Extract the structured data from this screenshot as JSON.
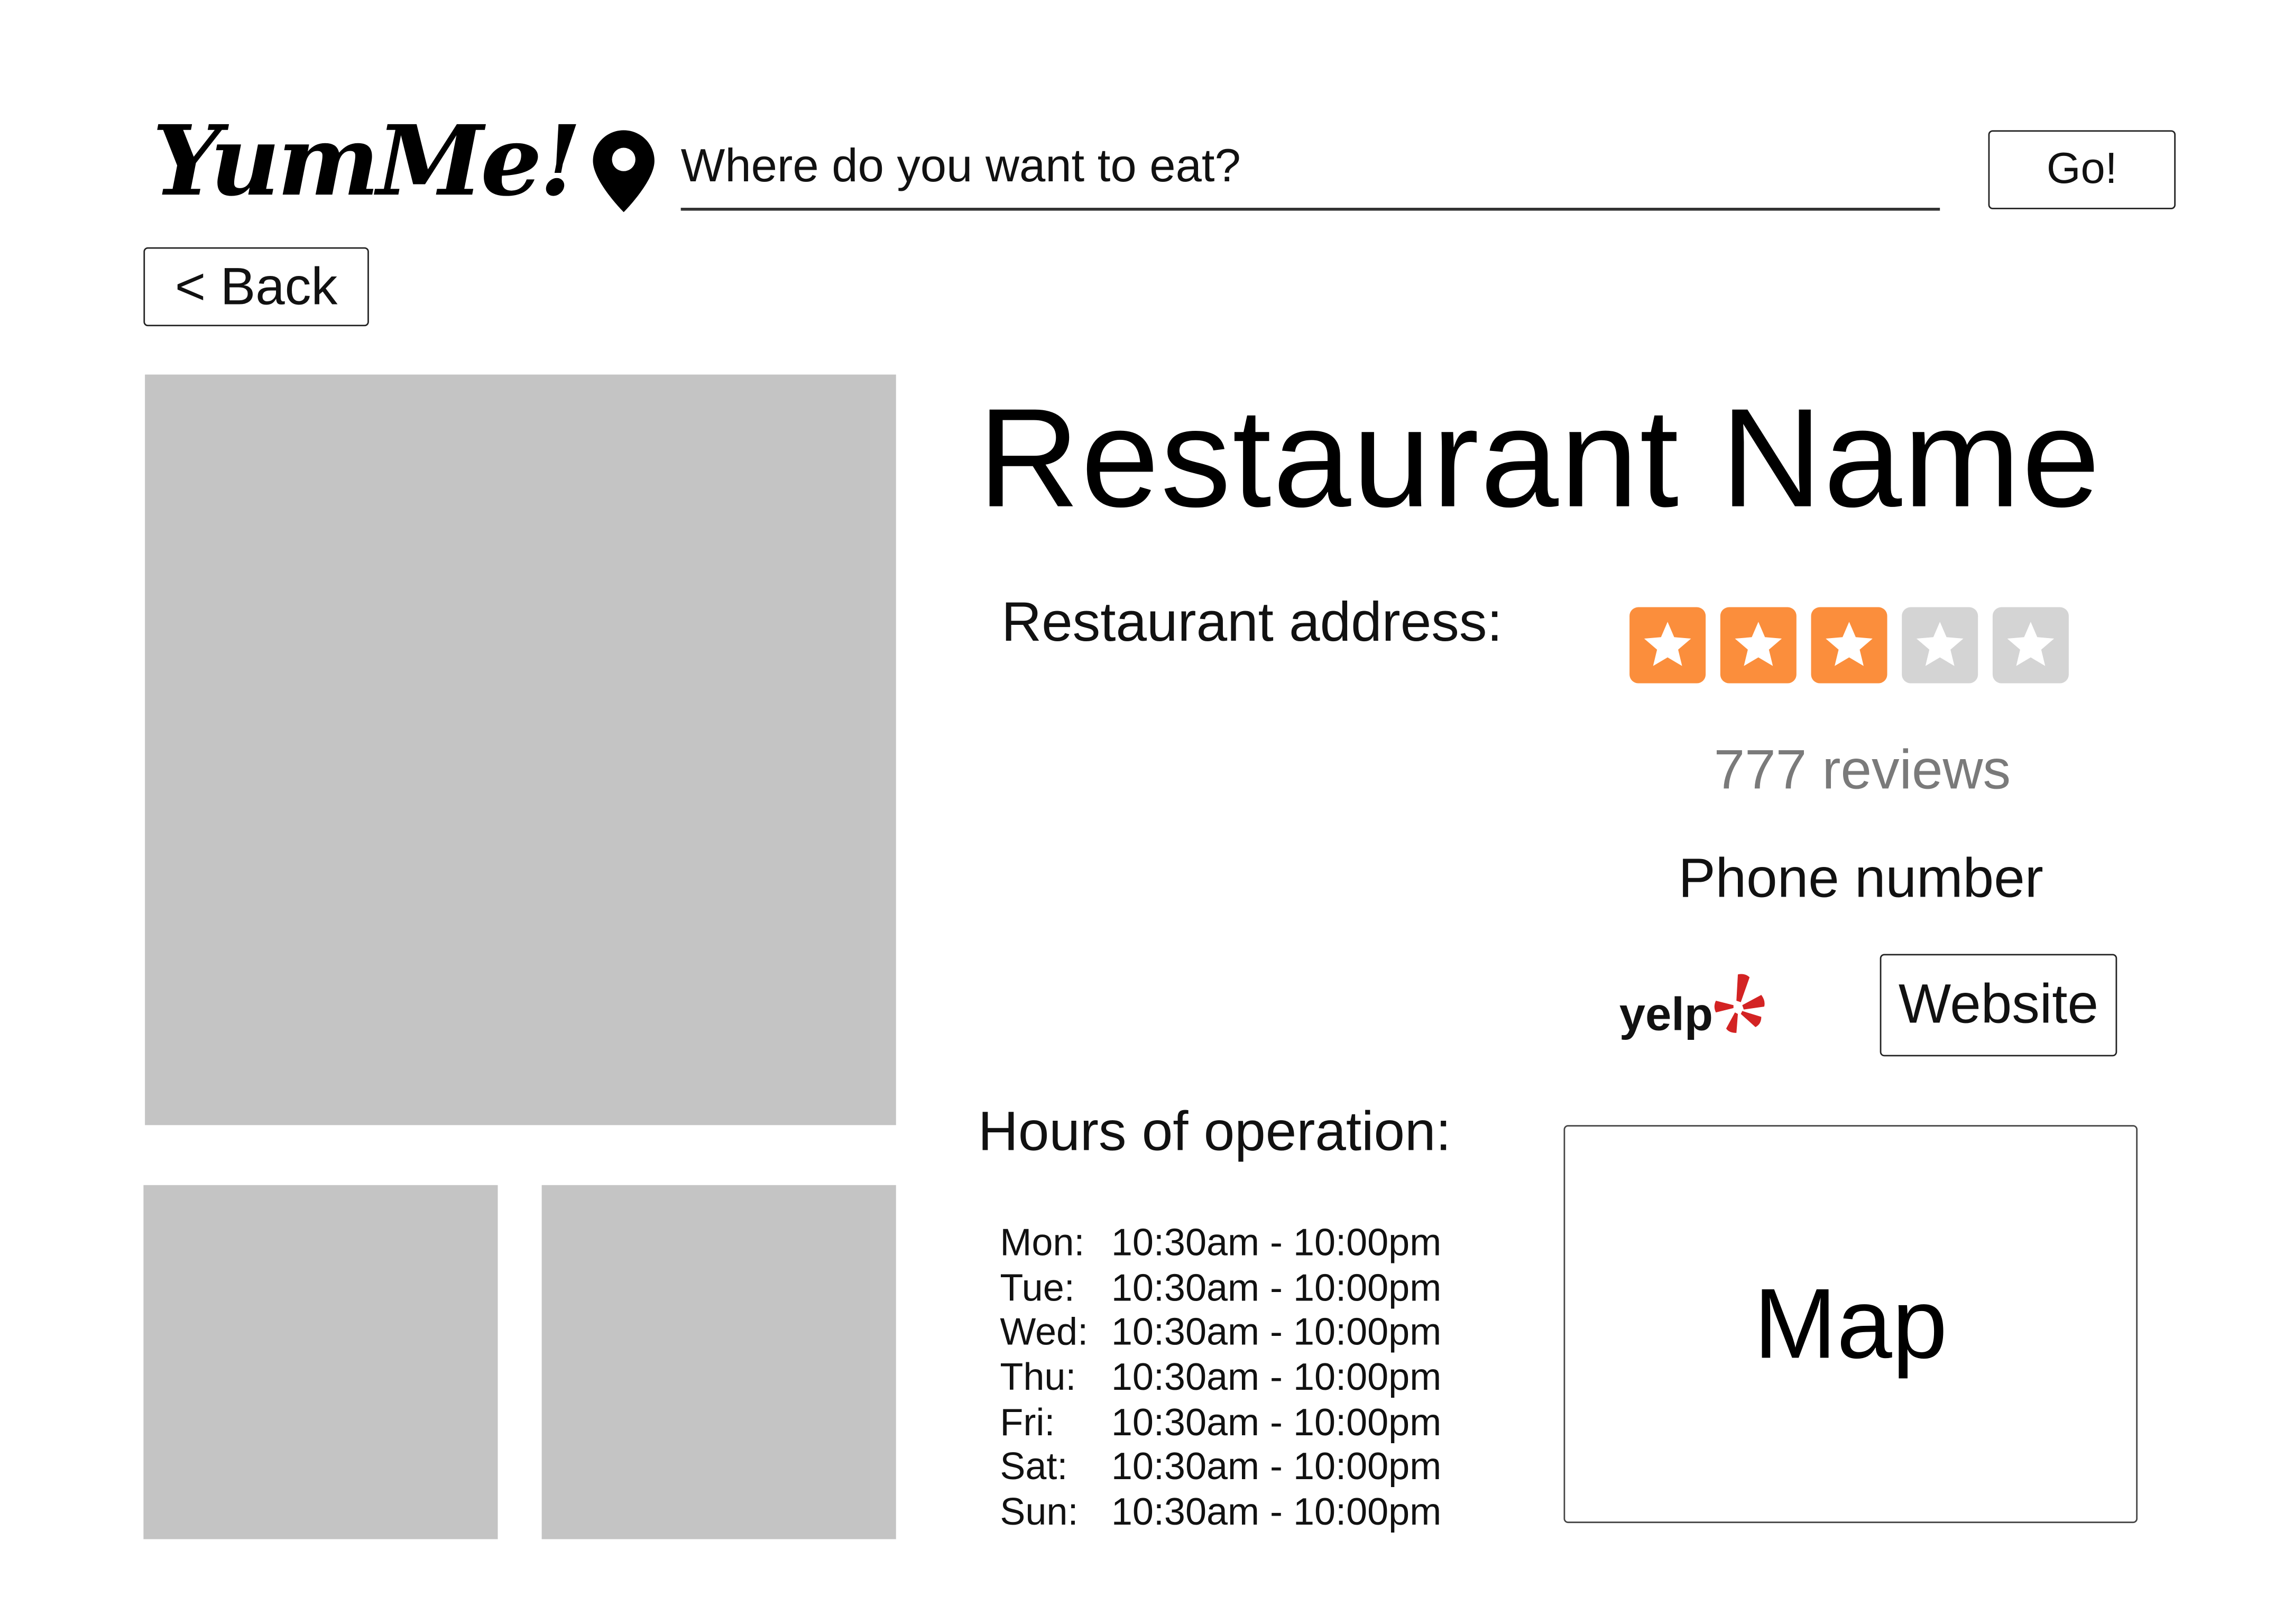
{
  "header": {
    "logo": "YumMe!",
    "search": {
      "placeholder": "Where do you want to eat?",
      "icon": "location-pin-icon"
    },
    "go_label": "Go!"
  },
  "nav": {
    "back_label": "< Back"
  },
  "restaurant": {
    "name": "Restaurant Name",
    "address_label": "Restaurant address:",
    "rating": {
      "value": 3,
      "max": 5,
      "filled_color": "#fb8e3c",
      "empty_color": "#d4d4d4",
      "star_color": "#ffffff"
    },
    "reviews": "777 reviews",
    "phone": "Phone number",
    "yelp": {
      "label": "yelp",
      "icon": "yelp-burst-icon",
      "burst_color": "#d32323"
    },
    "website_label": "Website",
    "hours_label": "Hours of operation:",
    "hours": [
      {
        "day": "Mon:",
        "time": "10:30am - 10:00pm"
      },
      {
        "day": "Tue:",
        "time": "10:30am - 10:00pm"
      },
      {
        "day": "Wed:",
        "time": "10:30am - 10:00pm"
      },
      {
        "day": "Thu:",
        "time": "10:30am - 10:00pm"
      },
      {
        "day": "Fri:",
        "time": "10:30am - 10:00pm"
      },
      {
        "day": "Sat:",
        "time": "10:30am - 10:00pm"
      },
      {
        "day": "Sun:",
        "time": "10:30am - 10:00pm"
      }
    ],
    "map_label": "Map"
  },
  "photos": {
    "placeholder_color": "#c4c4c4"
  }
}
